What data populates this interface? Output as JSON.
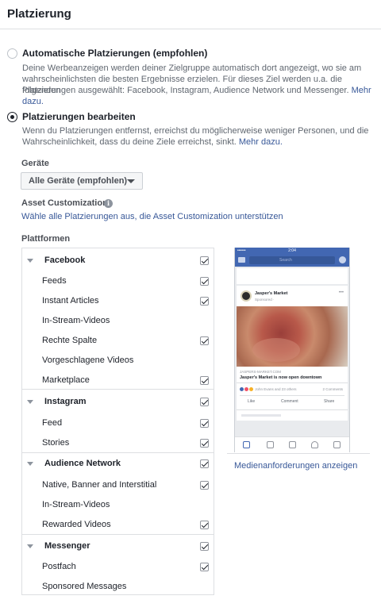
{
  "header": {
    "title": "Platzierung"
  },
  "auto_option": {
    "title": "Automatische Platzierungen (empfohlen)",
    "desc_line1": "Deine Werbeanzeigen werden deiner Zielgruppe automatisch dort angezeigt, wo sie am",
    "desc_line2": "wahrscheinlichsten die besten Ergebnisse erzielen. Für dieses Ziel werden u.a. die folgenden",
    "desc_line3": "Platzierungen ausgewählt: Facebook, Instagram, Audience Network und Messenger.",
    "more_link_a": "Mehr",
    "more_link_b": "dazu.",
    "selected": false
  },
  "edit_option": {
    "title": "Platzierungen bearbeiten",
    "desc_line1": "Wenn du Platzierungen entfernst, erreichst du möglicherweise weniger Personen, und die",
    "desc_line2": "Wahrscheinlichkeit, dass du deine Ziele erreichst, sinkt.",
    "more_link": "Mehr dazu.",
    "selected": true
  },
  "devices": {
    "label": "Geräte",
    "selected": "Alle Geräte (empfohlen)"
  },
  "asset_customization": {
    "label": "Asset Customization",
    "info_icon": "i",
    "link": "Wähle alle Platzierungen aus, die Asset Customization unterstützen"
  },
  "platforms": {
    "label": "Plattformen",
    "groups": [
      {
        "name": "Facebook",
        "checked": true,
        "items": [
          {
            "label": "Feeds",
            "checked": true
          },
          {
            "label": "Instant Articles",
            "checked": true
          },
          {
            "label": "In-Stream-Videos",
            "checked": false
          },
          {
            "label": "Rechte Spalte",
            "checked": true
          },
          {
            "label": "Vorgeschlagene Videos",
            "checked": false
          },
          {
            "label": "Marketplace",
            "checked": true
          }
        ]
      },
      {
        "name": "Instagram",
        "checked": true,
        "items": [
          {
            "label": "Feed",
            "checked": true
          },
          {
            "label": "Stories",
            "checked": true
          }
        ]
      },
      {
        "name": "Audience Network",
        "checked": true,
        "items": [
          {
            "label": "Native, Banner and Interstitial",
            "checked": true
          },
          {
            "label": "In-Stream-Videos",
            "checked": false
          },
          {
            "label": "Rewarded Videos",
            "checked": true
          }
        ]
      },
      {
        "name": "Messenger",
        "checked": true,
        "items": [
          {
            "label": "Postfach",
            "checked": true
          },
          {
            "label": "Sponsored Messages",
            "checked": false
          }
        ]
      }
    ]
  },
  "preview": {
    "status_time": "2:04",
    "carrier": "•••••• ",
    "search_placeholder": "Search",
    "page_name": "Jasper's Market",
    "sponsored": "Sponsored · ",
    "domain": "JASPERS-MARKET.COM",
    "headline": "Jasper's Market is now open downtown",
    "reactions_text": "John Evans and 23 others",
    "comments_text": "2 Comments",
    "like": "Like",
    "comment": "Comment",
    "share": "Share"
  },
  "media_link": "Medienanforderungen anzeigen",
  "colors": {
    "link": "#385898",
    "brand": "#4267b2",
    "border": "#dddfe2"
  }
}
